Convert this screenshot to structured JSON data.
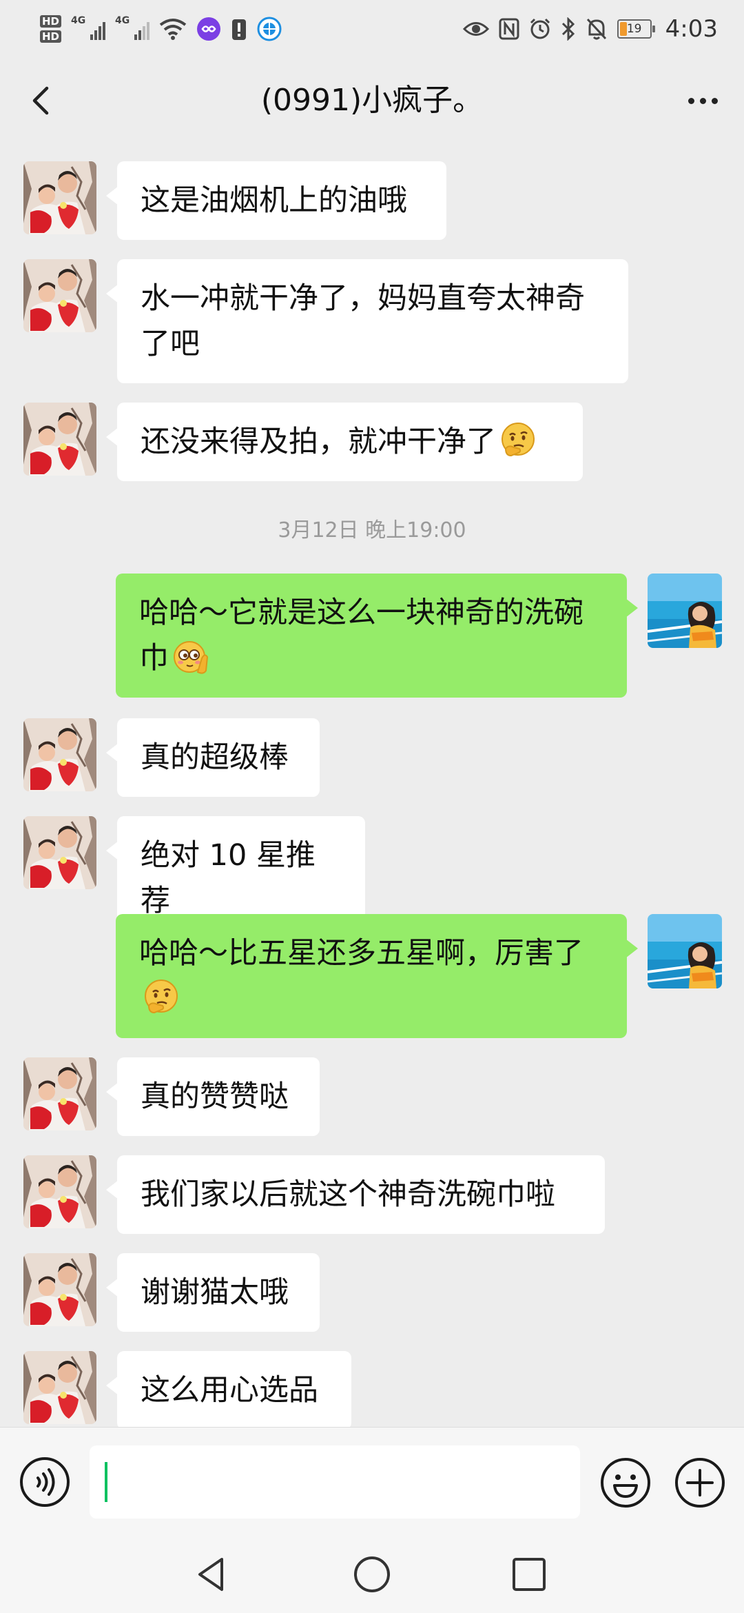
{
  "status_bar": {
    "hd1": "HD",
    "hd2": "HD",
    "net1": "4G",
    "net2": "4G",
    "battery": "19",
    "time": "4:03"
  },
  "header": {
    "title": "(0991)小疯子。"
  },
  "messages": [
    {
      "side": "left",
      "text": "这是油烟机上的油哦"
    },
    {
      "side": "left",
      "text": "水一冲就干净了，妈妈直夸太神奇了吧"
    },
    {
      "side": "left",
      "text": "还没来得及拍，就冲干净了",
      "emoji": "thinking-face"
    },
    {
      "timestamp": "3月12日 晚上19:00"
    },
    {
      "side": "right",
      "text": "哈哈～它就是这么一块神奇的洗碗巾",
      "emoji": "smirk-face"
    },
    {
      "side": "left",
      "text": "真的超级棒"
    },
    {
      "side": "left",
      "text": "绝对 10 星推荐"
    },
    {
      "side": "right",
      "text": "哈哈～比五星还多五星啊，厉害了",
      "emoji": "thinking-face"
    },
    {
      "side": "left",
      "text": "真的赞赞哒"
    },
    {
      "side": "left",
      "text": "我们家以后就这个神奇洗碗巾啦"
    },
    {
      "side": "left",
      "text": "谢谢猫太哦"
    },
    {
      "side": "left",
      "text": "这么用心选品"
    }
  ],
  "input": {
    "value": ""
  },
  "colors": {
    "background": "#ededed",
    "incoming_bubble": "#ffffff",
    "outgoing_bubble": "#95ec69",
    "caret": "#07c160"
  }
}
